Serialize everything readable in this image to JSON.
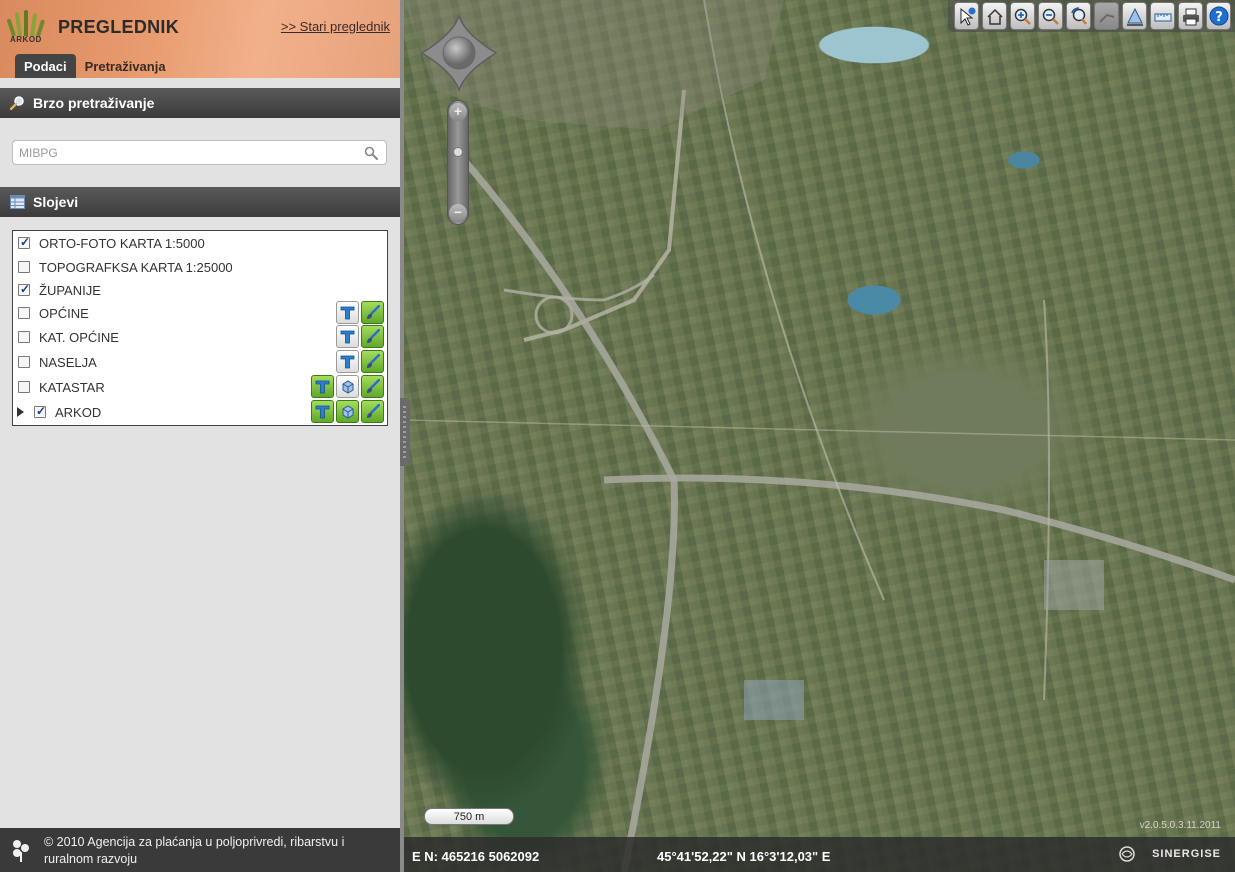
{
  "header": {
    "logo_text": "ARKOD",
    "app_title": "PREGLEDNIK",
    "old_viewer_link": ">> Stari preglednik",
    "tabs": [
      {
        "label": "Podaci",
        "active": true
      },
      {
        "label": "Pretraživanja",
        "active": false
      }
    ]
  },
  "quick_search": {
    "title": "Brzo pretraživanje",
    "placeholder": "MIBPG"
  },
  "layers": {
    "title": "Slojevi",
    "items": [
      {
        "name": "ORTO-FOTO KARTA 1:5000",
        "checked": true
      },
      {
        "name": "TOPOGRAFKSA KARTA 1:25000",
        "checked": false
      },
      {
        "name": "ŽUPANIJE",
        "checked": true
      },
      {
        "name": "OPĆINE",
        "checked": false
      },
      {
        "name": "KAT. OPĆINE",
        "checked": false
      },
      {
        "name": "NASELJA",
        "checked": false
      },
      {
        "name": "KATASTAR",
        "checked": false
      },
      {
        "name": "ARKOD",
        "checked": true
      }
    ]
  },
  "footer": {
    "copyright": "© 2010 Agencija za plaćanja u poljoprivredi, ribarstvu i ruralnom razvoju"
  },
  "map": {
    "scale_label": "750 m",
    "version": "v2.0.5.0.3.11.2011",
    "coords_en": "E N: 465216 5062092",
    "coords_geo": "45°41'52,22\" N 16°3'12,03\" E",
    "brand": "SINERGISE"
  },
  "toolbar": {
    "buttons": [
      "info-pointer",
      "home",
      "zoom-in",
      "zoom-out",
      "zoom-history",
      "measure-disabled",
      "measure-area",
      "measure-ruler",
      "print",
      "help"
    ]
  },
  "colors": {
    "accent_header": "#e79a6d",
    "section_bar": "#444444",
    "green_button": "#5fa829",
    "help_blue": "#1f6fd0"
  }
}
